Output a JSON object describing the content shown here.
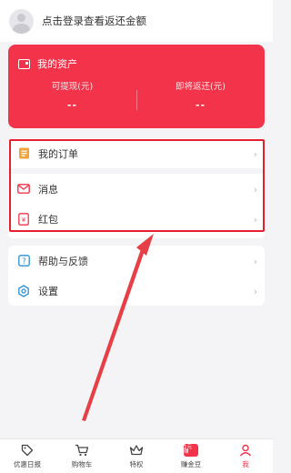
{
  "header": {
    "login_prompt": "点击登录查看返还金额"
  },
  "assets": {
    "title": "我的资产",
    "withdrawable_label": "可提现(元)",
    "withdrawable_value": "--",
    "pending_label": "即将返还(元)",
    "pending_value": "--"
  },
  "menu": {
    "orders": "我的订单",
    "messages": "消息",
    "red_packet": "红包",
    "help": "帮助与反馈",
    "settings": "设置"
  },
  "tabbar": {
    "items": [
      "优惠日报",
      "购物车",
      "特权",
      "赚金豆",
      "我"
    ],
    "gold_badge_text": "1元\n赚"
  },
  "colors": {
    "brand_red": "#f2334a",
    "highlight_red": "#e3202b",
    "page_bg": "#f4f4f6"
  },
  "icons": [
    "avatar",
    "wallet-icon",
    "order-icon",
    "mail-icon",
    "red-packet-icon",
    "help-icon",
    "gear-icon",
    "tag-icon",
    "cart-icon",
    "crown-icon",
    "gold-bean-icon",
    "user-icon",
    "chevron-right-icon"
  ]
}
